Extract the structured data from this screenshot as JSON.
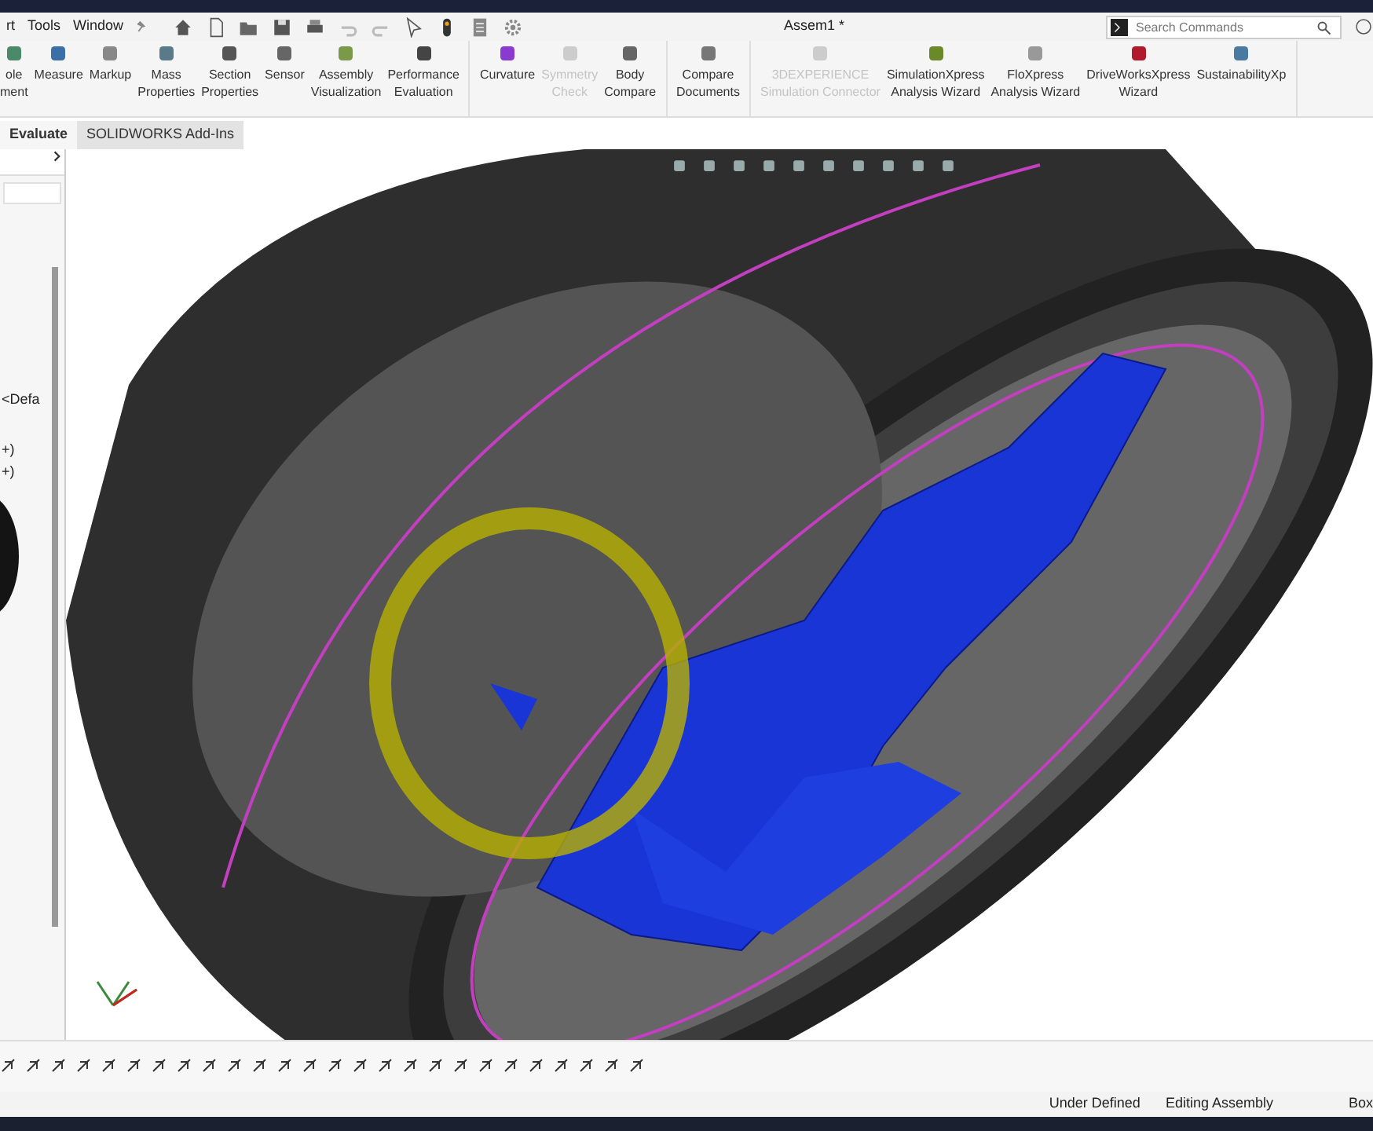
{
  "menu": [
    "rt",
    "Tools",
    "Window"
  ],
  "document_title": "Assem1 *",
  "search": {
    "placeholder": "Search Commands"
  },
  "ribbon_groups": [
    [
      {
        "lines": [
          "ole",
          "ment"
        ],
        "disabled": false
      },
      {
        "lines": [
          "Measure"
        ],
        "disabled": false
      },
      {
        "lines": [
          "Markup"
        ],
        "disabled": false
      },
      {
        "lines": [
          "Mass",
          "Properties"
        ],
        "disabled": false
      },
      {
        "lines": [
          "Section",
          "Properties"
        ],
        "disabled": false
      },
      {
        "lines": [
          "Sensor"
        ],
        "disabled": false
      },
      {
        "lines": [
          "Assembly",
          "Visualization"
        ],
        "disabled": false
      },
      {
        "lines": [
          "Performance",
          "Evaluation"
        ],
        "disabled": false
      }
    ],
    [
      {
        "lines": [
          "Curvature"
        ],
        "disabled": false
      },
      {
        "lines": [
          "Symmetry",
          "Check"
        ],
        "disabled": true
      },
      {
        "lines": [
          "Body",
          "Compare"
        ],
        "disabled": false
      }
    ],
    [
      {
        "lines": [
          "Compare",
          "Documents"
        ],
        "disabled": false
      }
    ],
    [
      {
        "lines": [
          "3DEXPERIENCE",
          "Simulation Connector"
        ],
        "disabled": true
      },
      {
        "lines": [
          "SimulationXpress",
          "Analysis Wizard"
        ],
        "disabled": false
      },
      {
        "lines": [
          "FloXpress",
          "Analysis Wizard"
        ],
        "disabled": false
      },
      {
        "lines": [
          "DriveWorksXpress",
          "Wizard"
        ],
        "disabled": false
      },
      {
        "lines": [
          "SustainabilityXp"
        ],
        "disabled": false
      }
    ]
  ],
  "tabs": [
    {
      "label": "Evaluate",
      "selected": true
    },
    {
      "label": "SOLIDWORKS Add-Ins",
      "selected": false
    }
  ],
  "tree_items": [
    "<Defa",
    "+)",
    "+)"
  ],
  "status_bar": [
    "Under Defined",
    "Editing Assembly",
    "Box"
  ]
}
